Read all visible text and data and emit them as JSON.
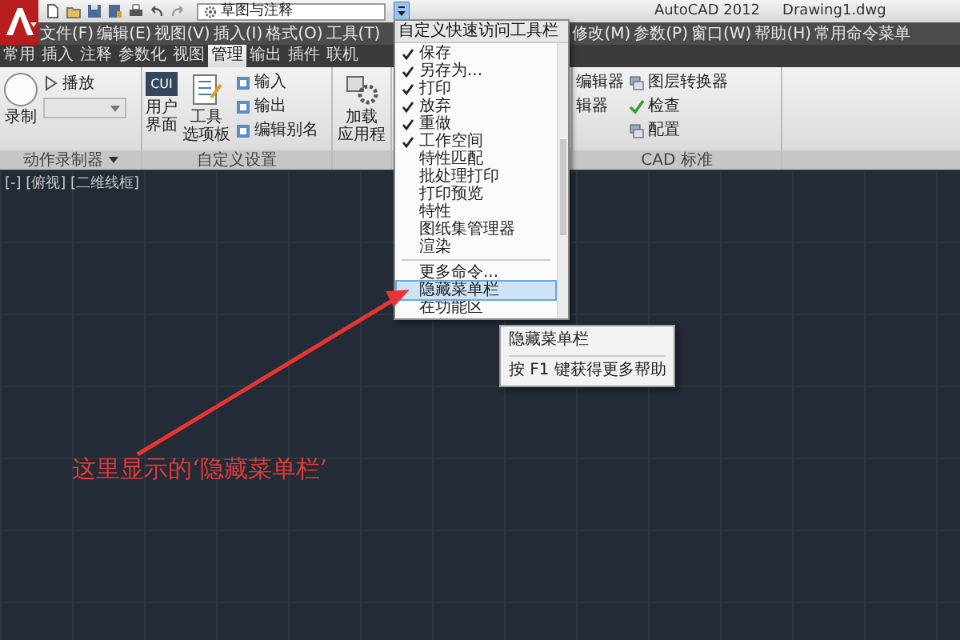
{
  "title_bar": {
    "workspace": "草图与注释",
    "app_title": "AutoCAD 2012",
    "file_name": "Drawing1.dwg"
  },
  "menu_bar": [
    "文件(F)",
    "编辑(E)",
    "视图(V)",
    "插入(I)",
    "格式(O)",
    "工具(T)",
    "修改(M)",
    "参数(P)",
    "窗口(W)",
    "帮助(H)",
    "常用命令菜单"
  ],
  "ribbon_tabs": [
    {
      "label": "常用",
      "selected": false
    },
    {
      "label": "插入",
      "selected": false
    },
    {
      "label": "注释",
      "selected": false
    },
    {
      "label": "参数化",
      "selected": false
    },
    {
      "label": "视图",
      "selected": false
    },
    {
      "label": "管理",
      "selected": true
    },
    {
      "label": "输出",
      "selected": false
    },
    {
      "label": "插件",
      "selected": false
    },
    {
      "label": "联机",
      "selected": false
    }
  ],
  "ribbon": {
    "recorder": {
      "title": "动作录制器",
      "record": "录制",
      "play": "播放"
    },
    "customize": {
      "title": "自定义设置",
      "cui_icon": "CUI",
      "user_interface": [
        "用户",
        "界面"
      ],
      "tool_palettes": [
        "工具",
        "选项板"
      ],
      "small": [
        "输入",
        "输出",
        "编辑别名"
      ]
    },
    "applications": {
      "load": [
        "加载",
        "应用程"
      ]
    },
    "editors": [
      "编辑器",
      "辑器"
    ],
    "cad_standards": {
      "title": "CAD 标准",
      "small": [
        "图层转换器",
        "检查",
        "配置"
      ]
    }
  },
  "viewport_label": "[-] [俯视] [二维线框]",
  "qat_menu": {
    "title": "自定义快速访问工具栏",
    "items": [
      {
        "kind": "item",
        "label": "保存",
        "checked": true,
        "selected": false
      },
      {
        "kind": "item",
        "label": "另存为...",
        "checked": true,
        "selected": false
      },
      {
        "kind": "item",
        "label": "打印",
        "checked": true,
        "selected": false
      },
      {
        "kind": "item",
        "label": "放弃",
        "checked": true,
        "selected": false
      },
      {
        "kind": "item",
        "label": "重做",
        "checked": true,
        "selected": false
      },
      {
        "kind": "item",
        "label": "工作空间",
        "checked": true,
        "selected": false
      },
      {
        "kind": "item",
        "label": "特性匹配",
        "checked": false,
        "selected": false
      },
      {
        "kind": "item",
        "label": "批处理打印",
        "checked": false,
        "selected": false
      },
      {
        "kind": "item",
        "label": "打印预览",
        "checked": false,
        "selected": false
      },
      {
        "kind": "item",
        "label": "特性",
        "checked": false,
        "selected": false
      },
      {
        "kind": "item",
        "label": "图纸集管理器",
        "checked": false,
        "selected": false
      },
      {
        "kind": "item",
        "label": "渲染",
        "checked": false,
        "selected": false
      },
      {
        "kind": "separator"
      },
      {
        "kind": "item",
        "label": "更多命令...",
        "checked": false,
        "selected": false
      },
      {
        "kind": "item",
        "label": "隐藏菜单栏",
        "checked": false,
        "selected": true
      },
      {
        "kind": "item",
        "label": "在功能区",
        "checked": false,
        "selected": false
      }
    ]
  },
  "tooltip": {
    "title": "隐藏菜单栏",
    "hint": "按 F1 键获得更多帮助"
  },
  "annotation": "这里显示的‘隐藏菜单栏’"
}
